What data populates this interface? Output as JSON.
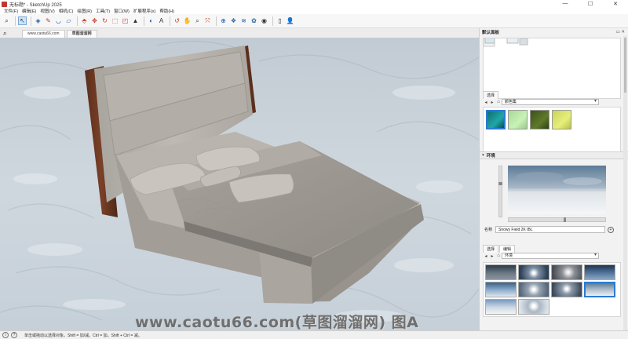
{
  "window": {
    "title": "无标题* - SketchUp 2025",
    "controls": [
      "—",
      "☐",
      "✕"
    ]
  },
  "menu": [
    "文件(F)",
    "编辑(E)",
    "视图(V)",
    "相机(C)",
    "绘图(R)",
    "工具(T)",
    "窗口(W)",
    "扩展程序(x)",
    "帮助(H)"
  ],
  "toolbar": {
    "icons": [
      {
        "name": "search-icon",
        "glyph": "⌕",
        "tone": "dark"
      },
      {
        "name": "select-arrow-icon",
        "glyph": "↖",
        "tone": "dark",
        "active": true
      },
      {
        "name": "eraser-icon",
        "glyph": "◈",
        "tone": "blue"
      },
      {
        "name": "line-pencil-icon",
        "glyph": "✎",
        "tone": "red"
      },
      {
        "name": "arc-icon",
        "glyph": "◡",
        "tone": "blue"
      },
      {
        "name": "rectangle-icon",
        "glyph": "▱",
        "tone": "blue"
      },
      {
        "name": "push-pull-icon",
        "glyph": "⬘",
        "tone": "red"
      },
      {
        "name": "move-icon",
        "glyph": "✥",
        "tone": "red"
      },
      {
        "name": "rotate-icon",
        "glyph": "↻",
        "tone": "red"
      },
      {
        "name": "scale-icon",
        "glyph": "⬚",
        "tone": "red"
      },
      {
        "name": "offset-icon",
        "glyph": "◰",
        "tone": "red"
      },
      {
        "name": "tape-measure-icon",
        "glyph": "▲",
        "tone": "dark"
      },
      {
        "name": "paint-bucket-icon",
        "glyph": "◐",
        "tone": "blue"
      },
      {
        "name": "text-icon",
        "glyph": "A",
        "tone": "dark"
      },
      {
        "name": "orbit-icon",
        "glyph": "↺",
        "tone": "red"
      },
      {
        "name": "pan-icon",
        "glyph": "✋",
        "tone": "dark"
      },
      {
        "name": "zoom-icon",
        "glyph": "⌕",
        "tone": "dark"
      },
      {
        "name": "zoom-extents-icon",
        "glyph": "⤧",
        "tone": "red"
      },
      {
        "name": "warehouse-icon",
        "glyph": "⊕",
        "tone": "blue"
      },
      {
        "name": "extension-icon",
        "glyph": "❖",
        "tone": "blue"
      },
      {
        "name": "layout-icon",
        "glyph": "≋",
        "tone": "blue"
      },
      {
        "name": "style-icon",
        "glyph": "✿",
        "tone": "blue"
      },
      {
        "name": "profile-icon",
        "glyph": "◉",
        "tone": "dark"
      },
      {
        "name": "new-file-icon",
        "glyph": "▯",
        "tone": "dark"
      },
      {
        "name": "user-icon",
        "glyph": "👤",
        "tone": "dark"
      }
    ]
  },
  "scene_tabs": {
    "tabs": [
      {
        "label": "www.caotu66.com",
        "active": false
      },
      {
        "label": "草图溜溜网",
        "active": true
      }
    ]
  },
  "viewport": {
    "watermark": "www.caotu66.com(草图溜溜网) 图A"
  },
  "tray": {
    "title": "默认面板",
    "controls": "▭ ✕",
    "materials": {
      "tabs": [
        "选择"
      ],
      "dropdown": "颜色集",
      "swatches": [
        "#1fa7a8",
        "#c8f2b6",
        "#5e7a2a",
        "#e7ef7a"
      ]
    },
    "environment": {
      "section_label": "环境",
      "name_label": "名称",
      "name_value": "Snowy Field 2K IBL",
      "name_button": "+",
      "tabs": [
        "选择",
        "编辑"
      ],
      "dropdown": "环境"
    }
  },
  "statusbar": {
    "icons": [
      "info-icon",
      "question-icon"
    ],
    "text": "单击或拖动以选择对象。Shift = 加/减。Ctrl = 加。Shift + Ctrl = 减。"
  }
}
